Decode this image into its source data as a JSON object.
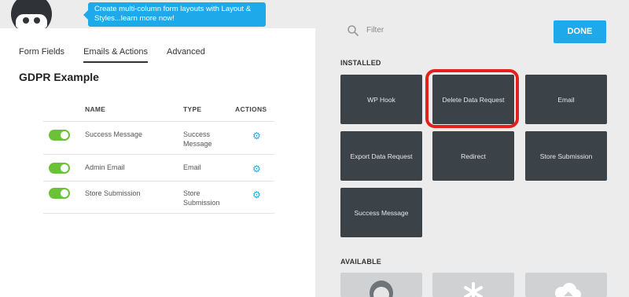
{
  "tooltip": {
    "text": "Create multi-column form layouts with Layout & Styles...learn more now!"
  },
  "tabs": [
    {
      "label": "Form Fields"
    },
    {
      "label": "Emails & Actions"
    },
    {
      "label": "Advanced"
    }
  ],
  "form_title": "GDPR Example",
  "table": {
    "headers": {
      "name": "NAME",
      "type": "TYPE",
      "actions": "ACTIONS"
    },
    "rows": [
      {
        "name": "Success Message",
        "type_line1": "Success",
        "type_line2": "Message",
        "enabled": true
      },
      {
        "name": "Admin Email",
        "type_line1": "Email",
        "type_line2": "",
        "enabled": true
      },
      {
        "name": "Store Submission",
        "type_line1": "Store",
        "type_line2": "Submission",
        "enabled": true
      }
    ]
  },
  "filter": {
    "placeholder": "Filter"
  },
  "done_button": "DONE",
  "installed_label": "INSTALLED",
  "available_label": "AVAILABLE",
  "installed_actions": [
    {
      "label": "WP Hook"
    },
    {
      "label": "Delete Data Request"
    },
    {
      "label": "Email"
    },
    {
      "label": "Export Data Request"
    },
    {
      "label": "Redirect"
    },
    {
      "label": "Store Submission"
    },
    {
      "label": "Success Message"
    }
  ],
  "colors": {
    "accent": "#1ea9ea",
    "toggle_on": "#6bc236",
    "card_bg": "#3b4248",
    "highlight": "#e4201e"
  },
  "icons": {
    "filter": "search-icon",
    "action_settings": "gear-icon"
  }
}
